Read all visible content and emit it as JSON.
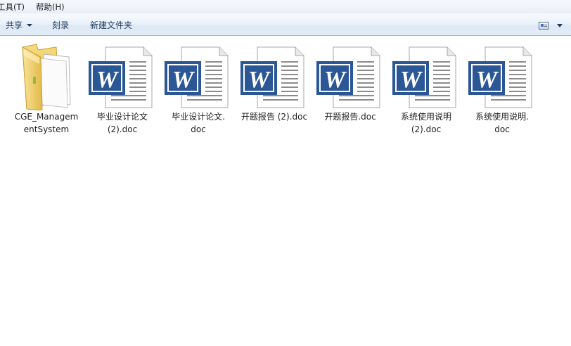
{
  "menubar": {
    "tools": "工具(T)",
    "help": "帮助(H)"
  },
  "toolbar": {
    "share": "共享",
    "burn": "刻录",
    "new_folder": "新建文件夹"
  },
  "files": [
    {
      "type": "folder",
      "line1": "CGE_Managem",
      "line2": "entSystem"
    },
    {
      "type": "word",
      "line1": "毕业设计论文",
      "line2": "(2).doc"
    },
    {
      "type": "word",
      "line1": "毕业设计论文.",
      "line2": "doc"
    },
    {
      "type": "word",
      "line1": "开题报告 (2).doc",
      "line2": ""
    },
    {
      "type": "word",
      "line1": "开题报告.doc",
      "line2": ""
    },
    {
      "type": "word",
      "line1": "系统使用说明",
      "line2": "(2).doc"
    },
    {
      "type": "word",
      "line1": "系统使用说明.",
      "line2": "doc"
    }
  ],
  "colors": {
    "word_blue": "#2b5797",
    "folder_yellow": "#f3d36b"
  }
}
